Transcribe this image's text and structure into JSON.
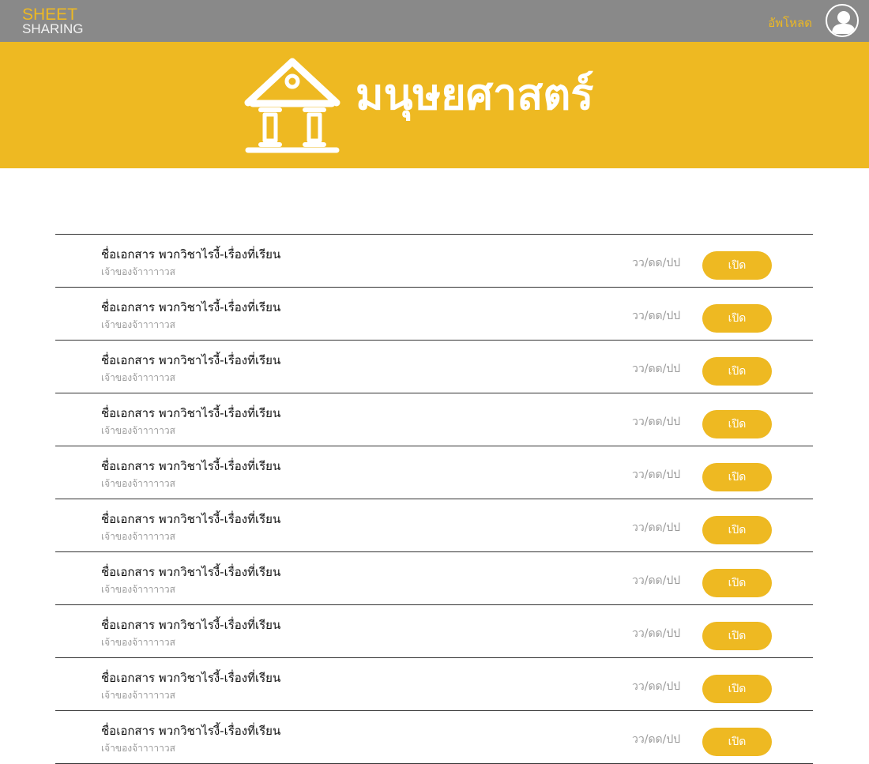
{
  "header": {
    "logo_line1": "SHEET",
    "logo_line2": "SHARING",
    "upload_label": "อัพโหลด",
    "avatar_icon": "user-avatar-icon"
  },
  "banner": {
    "title": "มนุษยศาสตร์",
    "icon": "building-columns-icon"
  },
  "colors": {
    "accent": "#eeb922",
    "topbar": "#898989",
    "divider": "#333333",
    "muted_text": "#9a9a9a"
  },
  "documents": [
    {
      "name": "ชื่อเอกสาร พวกวิชาไรงี้-เรื่องที่เรียน",
      "owner": "เจ้าของจ้าาาาาวส",
      "date": "วว/ดด/ปป",
      "action": "เปิด"
    },
    {
      "name": "ชื่อเอกสาร พวกวิชาไรงี้-เรื่องที่เรียน",
      "owner": "เจ้าของจ้าาาาาวส",
      "date": "วว/ดด/ปป",
      "action": "เปิด"
    },
    {
      "name": "ชื่อเอกสาร พวกวิชาไรงี้-เรื่องที่เรียน",
      "owner": "เจ้าของจ้าาาาาวส",
      "date": "วว/ดด/ปป",
      "action": "เปิด"
    },
    {
      "name": "ชื่อเอกสาร พวกวิชาไรงี้-เรื่องที่เรียน",
      "owner": "เจ้าของจ้าาาาาวส",
      "date": "วว/ดด/ปป",
      "action": "เปิด"
    },
    {
      "name": "ชื่อเอกสาร พวกวิชาไรงี้-เรื่องที่เรียน",
      "owner": "เจ้าของจ้าาาาาวส",
      "date": "วว/ดด/ปป",
      "action": "เปิด"
    },
    {
      "name": "ชื่อเอกสาร พวกวิชาไรงี้-เรื่องที่เรียน",
      "owner": "เจ้าของจ้าาาาาวส",
      "date": "วว/ดด/ปป",
      "action": "เปิด"
    },
    {
      "name": "ชื่อเอกสาร พวกวิชาไรงี้-เรื่องที่เรียน",
      "owner": "เจ้าของจ้าาาาาวส",
      "date": "วว/ดด/ปป",
      "action": "เปิด"
    },
    {
      "name": "ชื่อเอกสาร พวกวิชาไรงี้-เรื่องที่เรียน",
      "owner": "เจ้าของจ้าาาาาวส",
      "date": "วว/ดด/ปป",
      "action": "เปิด"
    },
    {
      "name": "ชื่อเอกสาร พวกวิชาไรงี้-เรื่องที่เรียน",
      "owner": "เจ้าของจ้าาาาาวส",
      "date": "วว/ดด/ปป",
      "action": "เปิด"
    },
    {
      "name": "ชื่อเอกสาร พวกวิชาไรงี้-เรื่องที่เรียน",
      "owner": "เจ้าของจ้าาาาาวส",
      "date": "วว/ดด/ปป",
      "action": "เปิด"
    }
  ]
}
